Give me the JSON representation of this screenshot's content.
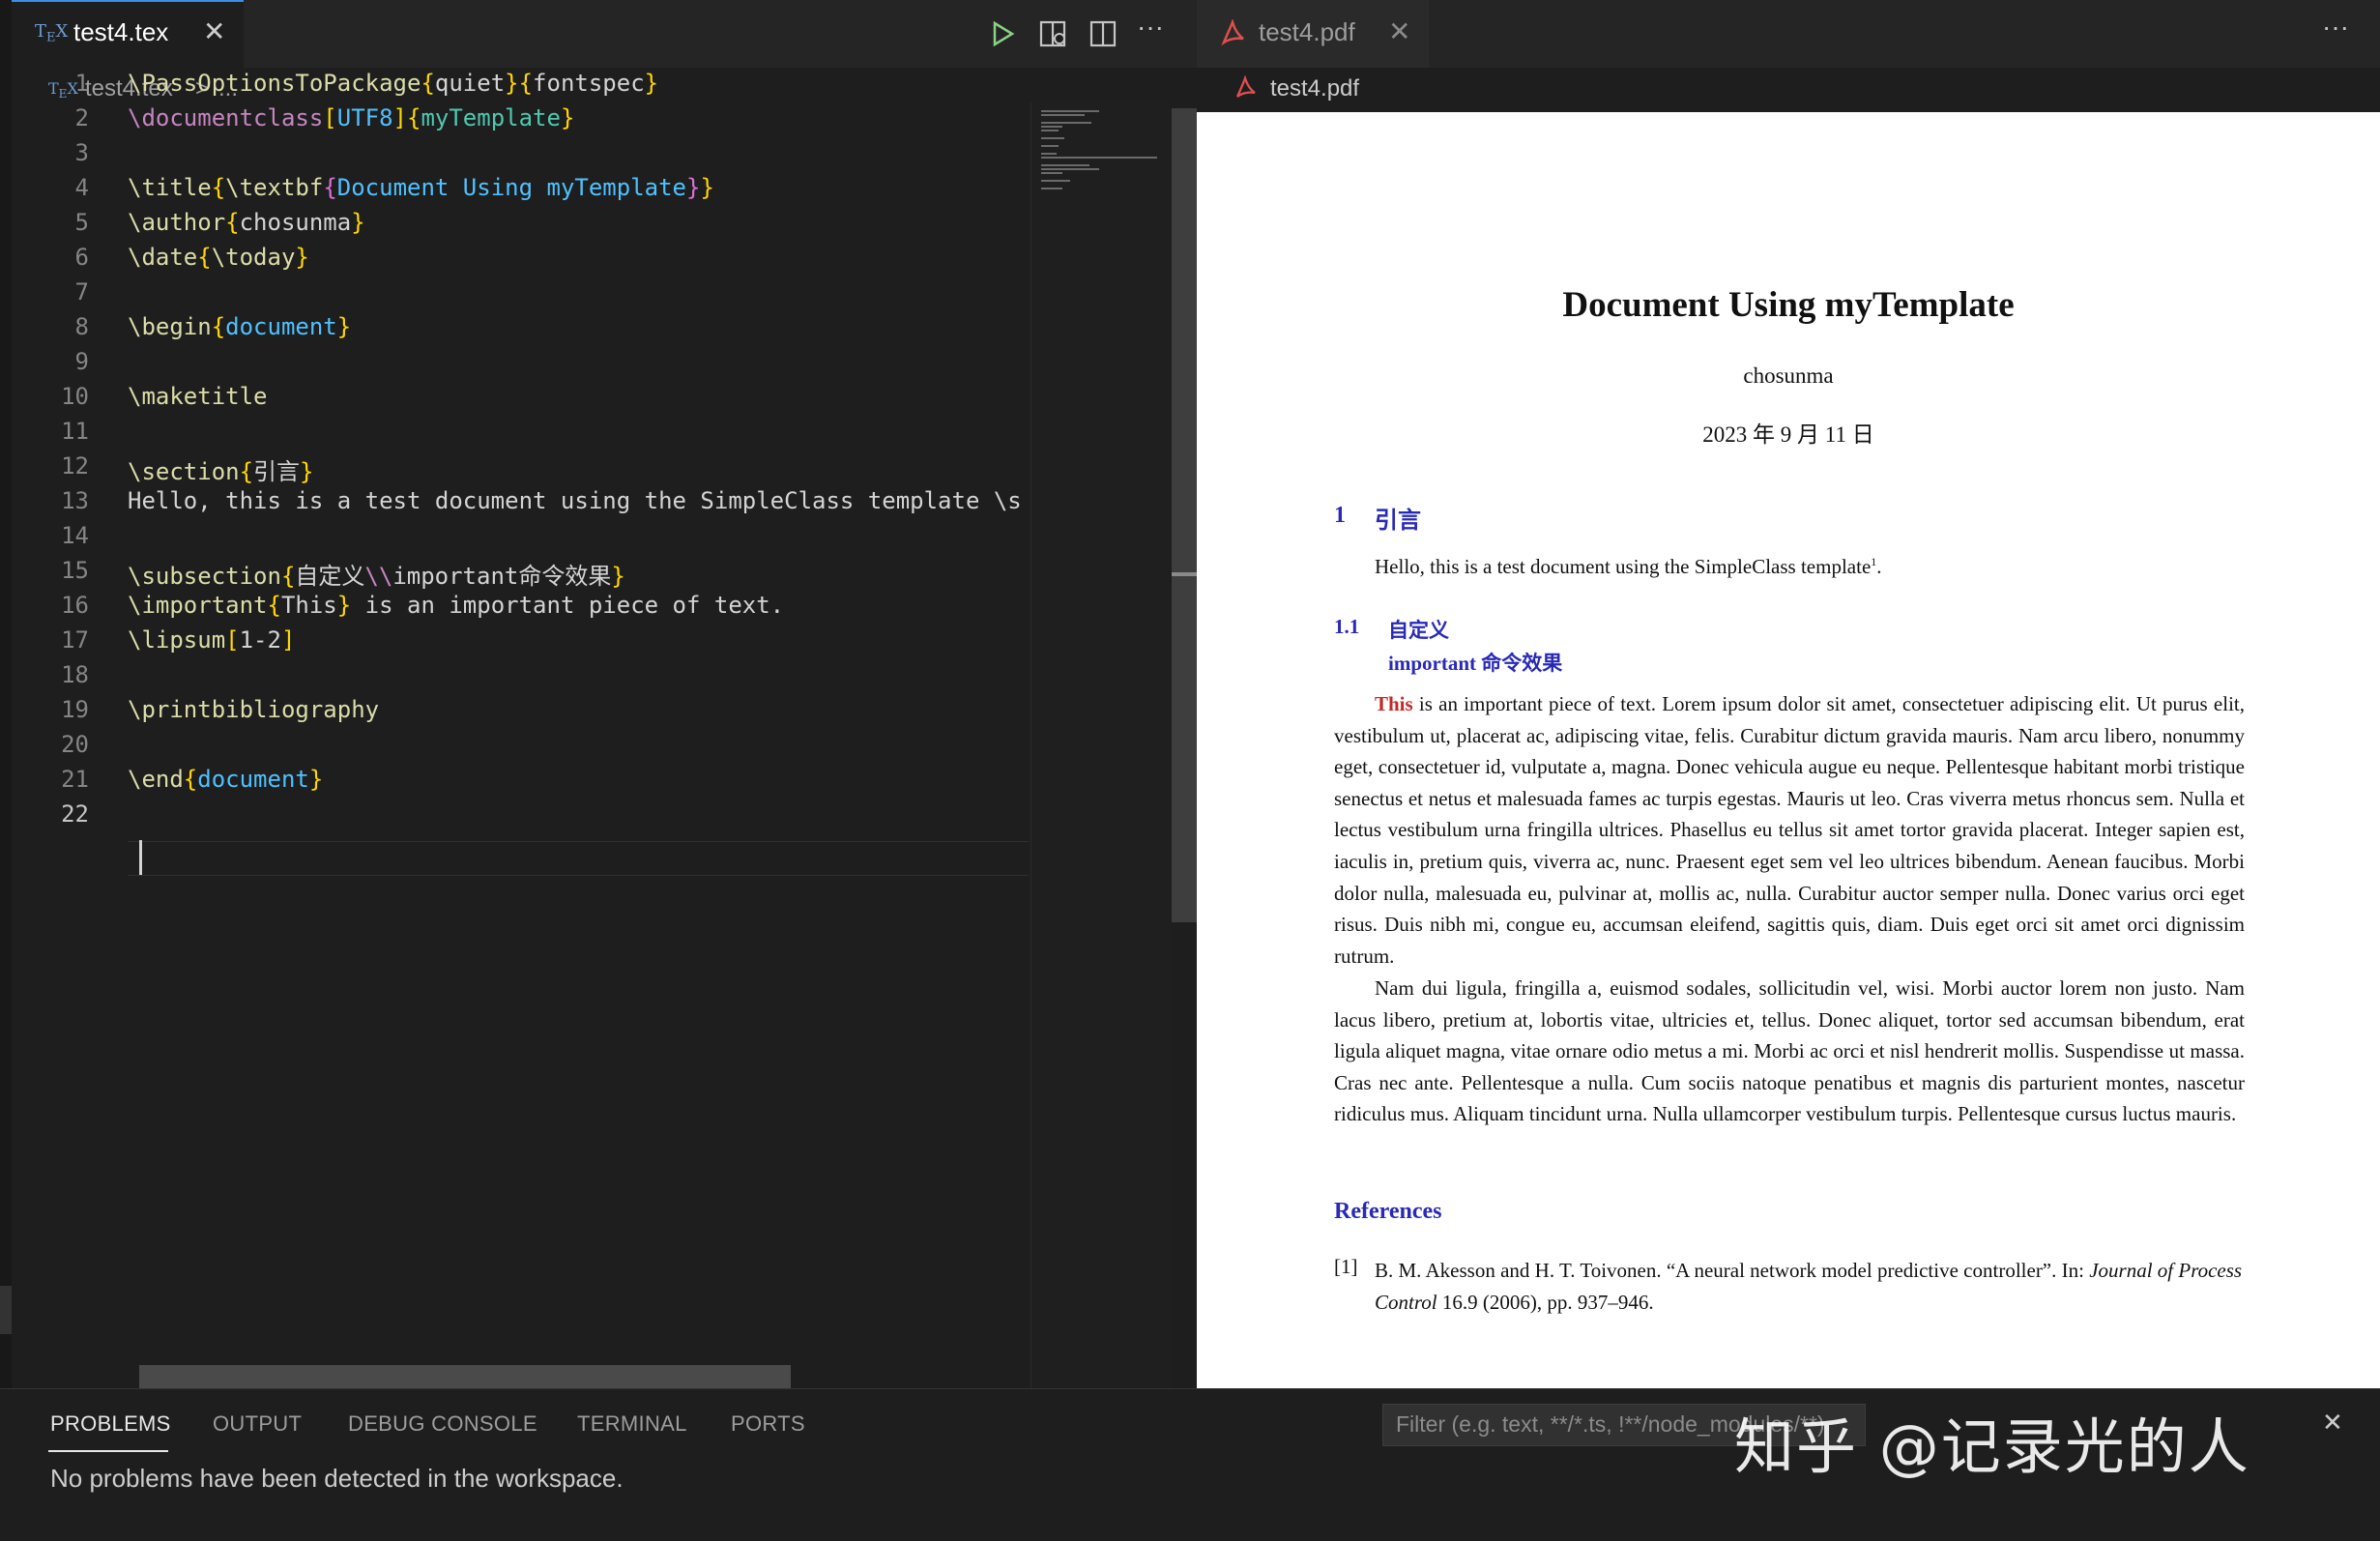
{
  "left_tab": {
    "icon": "tex-file-icon",
    "title": "test4.tex",
    "close": "✕"
  },
  "toolbar": {
    "run": "▷",
    "preview": "⧉",
    "split": "◫",
    "more": "···"
  },
  "left_breadcrumb": {
    "file": "test4.tex",
    "sep": ">",
    "more": "..."
  },
  "code_lines": [
    {
      "n": "1",
      "parts": [
        [
          "\\PassOptionsToPackage",
          "k2"
        ],
        [
          "{",
          "p"
        ],
        [
          "quiet",
          ""
        ],
        [
          "}{",
          "p"
        ],
        [
          "fontspec",
          ""
        ],
        [
          "}",
          "p"
        ]
      ]
    },
    {
      "n": "2",
      "parts": [
        [
          "\\documentclass",
          "m"
        ],
        [
          "[",
          "p"
        ],
        [
          "UTF8",
          "b"
        ],
        [
          "]{",
          "p"
        ],
        [
          "myTemplate",
          "g"
        ],
        [
          "}",
          "p"
        ]
      ]
    },
    {
      "n": "3",
      "parts": []
    },
    {
      "n": "4",
      "parts": [
        [
          "\\title",
          "k2"
        ],
        [
          "{",
          "p"
        ],
        [
          "\\textbf",
          "k2"
        ],
        [
          "{",
          "p2"
        ],
        [
          "Document Using myTemplate",
          "b"
        ],
        [
          "}",
          "p2"
        ],
        [
          "}",
          "p"
        ]
      ]
    },
    {
      "n": "5",
      "parts": [
        [
          "\\author",
          "k2"
        ],
        [
          "{",
          "p"
        ],
        [
          "chosunma",
          ""
        ],
        [
          "}",
          "p"
        ]
      ]
    },
    {
      "n": "6",
      "parts": [
        [
          "\\date",
          "k2"
        ],
        [
          "{",
          "p"
        ],
        [
          "\\today",
          "k2"
        ],
        [
          "}",
          "p"
        ]
      ]
    },
    {
      "n": "7",
      "parts": []
    },
    {
      "n": "8",
      "parts": [
        [
          "\\begin",
          "k2"
        ],
        [
          "{",
          "p"
        ],
        [
          "document",
          "b"
        ],
        [
          "}",
          "p"
        ]
      ]
    },
    {
      "n": "9",
      "parts": []
    },
    {
      "n": "10",
      "parts": [
        [
          "\\maketitle",
          "k2"
        ]
      ]
    },
    {
      "n": "11",
      "parts": []
    },
    {
      "n": "12",
      "parts": [
        [
          "\\section",
          "k2"
        ],
        [
          "{",
          "p"
        ],
        [
          "引言",
          ""
        ],
        [
          "}",
          "p"
        ]
      ]
    },
    {
      "n": "13",
      "parts": [
        [
          "Hello, this is a test document using the SimpleClass template \\s",
          ""
        ]
      ]
    },
    {
      "n": "14",
      "parts": []
    },
    {
      "n": "15",
      "parts": [
        [
          "\\subsection",
          "k2"
        ],
        [
          "{",
          "p"
        ],
        [
          "自定义",
          ""
        ],
        [
          "\\\\",
          "m"
        ],
        [
          "important命令效果",
          ""
        ],
        [
          "}",
          "p"
        ]
      ]
    },
    {
      "n": "16",
      "parts": [
        [
          "\\important",
          "k2"
        ],
        [
          "{",
          "p"
        ],
        [
          "This",
          ""
        ],
        [
          "}",
          "p"
        ],
        [
          " is an important piece of text.",
          ""
        ]
      ]
    },
    {
      "n": "17",
      "parts": [
        [
          "\\lipsum",
          "k2"
        ],
        [
          "[",
          "p"
        ],
        [
          "1-2",
          ""
        ],
        [
          "]",
          "p"
        ]
      ]
    },
    {
      "n": "18",
      "parts": []
    },
    {
      "n": "19",
      "parts": [
        [
          "\\printbibliography",
          "k2"
        ]
      ]
    },
    {
      "n": "20",
      "parts": []
    },
    {
      "n": "21",
      "parts": [
        [
          "\\end",
          "k2"
        ],
        [
          "{",
          "p"
        ],
        [
          "document",
          "b"
        ],
        [
          "}",
          "p"
        ]
      ]
    },
    {
      "n": "22",
      "parts": []
    }
  ],
  "right_tab": {
    "title": "test4.pdf",
    "close": "✕",
    "more": "···"
  },
  "right_breadcrumb": {
    "file": "test4.pdf"
  },
  "pdf": {
    "title": "Document Using myTemplate",
    "author": "chosunma",
    "date": "2023 年 9 月 11 日",
    "section_num": "1",
    "section_title": "引言",
    "intro_text": "Hello, this is a test document using the SimpleClass template",
    "intro_footnote": "1",
    "intro_end": ".",
    "subsection_num": "1.1",
    "subsection_line1": "自定义",
    "subsection_line2": "important 命令效果",
    "para1_highlight": "This",
    "para1_rest": " is an important piece of text. Lorem ipsum dolor sit amet, consectetuer adipiscing elit. Ut purus elit, vestibulum ut, placerat ac, adipiscing vitae, felis. Curabitur dictum gravida mauris. Nam arcu libero, nonummy eget, consectetuer id, vulputate a, magna. Donec vehicula augue eu neque. Pellentesque habitant morbi tristique senectus et netus et malesuada fames ac turpis egestas. Mauris ut leo. Cras viverra metus rhoncus sem. Nulla et lectus vestibulum urna fringilla ultrices. Phasellus eu tellus sit amet tortor gravida placerat. Integer sapien est, iaculis in, pretium quis, viverra ac, nunc. Praesent eget sem vel leo ultrices bibendum. Aenean faucibus. Morbi dolor nulla, malesuada eu, pulvinar at, mollis ac, nulla. Curabitur auctor semper nulla. Donec varius orci eget risus. Duis nibh mi, congue eu, accumsan eleifend, sagittis quis, diam. Duis eget orci sit amet orci dignissim rutrum.",
    "para2": "Nam dui ligula, fringilla a, euismod sodales, sollicitudin vel, wisi. Morbi auctor lorem non justo. Nam lacus libero, pretium at, lobortis vitae, ultricies et, tellus. Donec aliquet, tortor sed accumsan bibendum, erat ligula aliquet magna, vitae ornare odio metus a mi. Morbi ac orci et nisl hendrerit mollis. Suspendisse ut massa. Cras nec ante. Pellentesque a nulla. Cum sociis natoque penatibus et magnis dis parturient montes, nascetur ridiculus mus. Aliquam tincidunt urna. Nulla ullamcorper vestibulum turpis. Pellentesque cursus luctus mauris.",
    "references_title": "References",
    "ref_num": "[1]",
    "ref_plain": "B. M. Akesson and H. T. Toivonen. “A neural network model predictive controller”. In: ",
    "ref_italic1": "Journal of",
    "ref_italic2": "Process Control",
    "ref_end": " 16.9 (2006), pp. 937–946."
  },
  "panel": {
    "tabs": [
      "PROBLEMS",
      "OUTPUT",
      "DEBUG CONSOLE",
      "TERMINAL",
      "PORTS"
    ],
    "filter_placeholder": "Filter (e.g. text, **/*.ts, !**/node_modules/**)",
    "message": "No problems have been detected in the workspace.",
    "close": "✕"
  },
  "watermark": "知乎 @记录光的人",
  "colors": {
    "accent": "#3b8eea",
    "pdf_blue": "#2929b8",
    "important_red": "#c62828"
  }
}
